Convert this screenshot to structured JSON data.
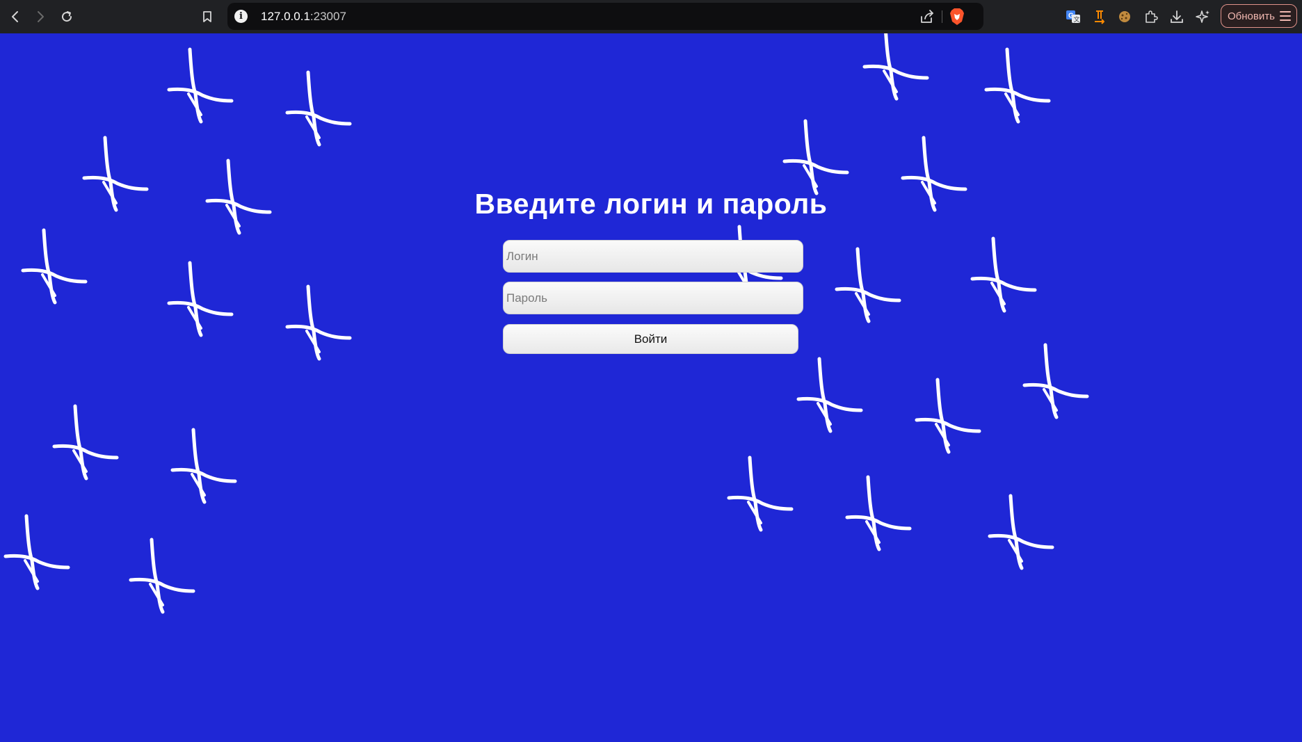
{
  "browser": {
    "url_host": "127.0.0.1",
    "url_rest": ":23007",
    "update_label": "Обновить"
  },
  "page": {
    "title": "Введите логин и пароль",
    "login_placeholder": "Логин",
    "password_placeholder": "Пароль",
    "submit_label": "Войти",
    "background_color": "#1f27d6",
    "decoration_color": "#ffffff"
  }
}
